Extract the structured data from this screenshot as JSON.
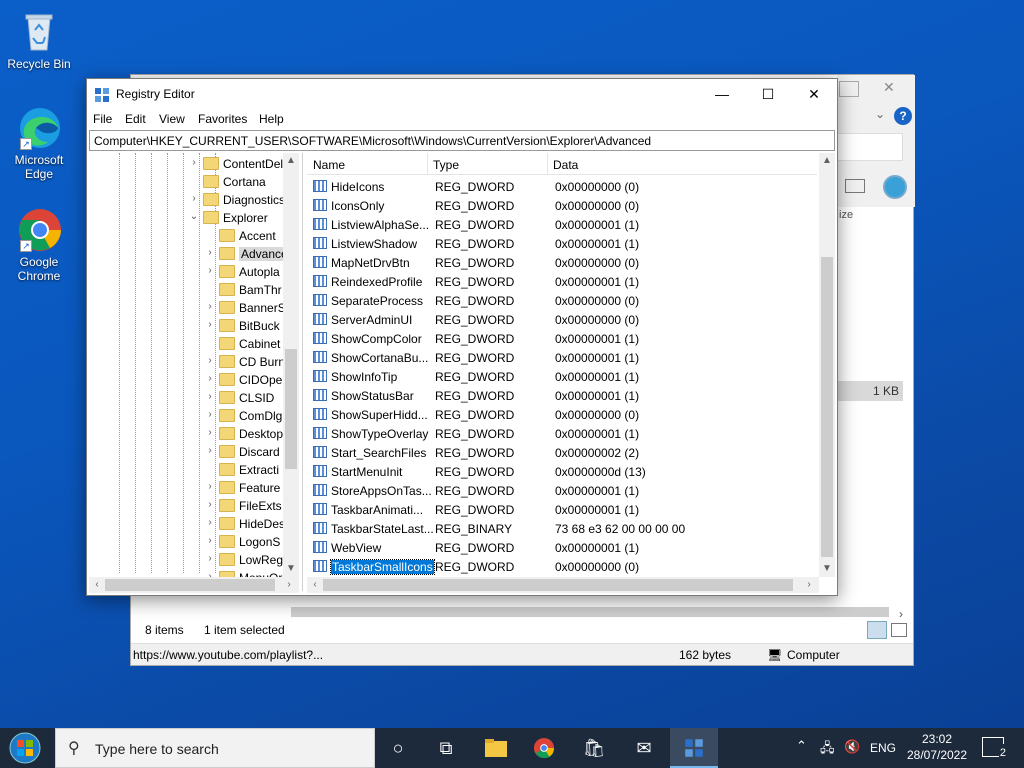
{
  "desktop": {
    "icons": [
      {
        "label": "Recycle Bin"
      },
      {
        "label": "Microsoft Edge"
      },
      {
        "label": "Google Chrome"
      }
    ]
  },
  "background_window": {
    "status_items_count": "8 items",
    "status_selected": "1 item selected",
    "status_url": "https://www.youtube.com/playlist?...",
    "status_size": "162 bytes",
    "status_location": "Computer",
    "column_size": "ize",
    "file_size": "1 KB"
  },
  "regedit": {
    "title": "Registry Editor",
    "menu": [
      "File",
      "Edit",
      "View",
      "Favorites",
      "Help"
    ],
    "address": "Computer\\HKEY_CURRENT_USER\\SOFTWARE\\Microsoft\\Windows\\CurrentVersion\\Explorer\\Advanced",
    "tree": [
      {
        "label": "ContentDel",
        "level": 1,
        "expander": "›"
      },
      {
        "label": "Cortana",
        "level": 1,
        "expander": ""
      },
      {
        "label": "Diagnostics",
        "level": 1,
        "expander": "›"
      },
      {
        "label": "Explorer",
        "level": 1,
        "expander": "⌄"
      },
      {
        "label": "Accent",
        "level": 2,
        "expander": ""
      },
      {
        "label": "Advance",
        "level": 2,
        "expander": "›",
        "selected": true
      },
      {
        "label": "Autopla",
        "level": 2,
        "expander": "›"
      },
      {
        "label": "BamThr",
        "level": 2,
        "expander": ""
      },
      {
        "label": "BannerS",
        "level": 2,
        "expander": "›"
      },
      {
        "label": "BitBuck",
        "level": 2,
        "expander": "›"
      },
      {
        "label": "Cabinet",
        "level": 2,
        "expander": ""
      },
      {
        "label": "CD Burn",
        "level": 2,
        "expander": "›"
      },
      {
        "label": "CIDOpe",
        "level": 2,
        "expander": "›"
      },
      {
        "label": "CLSID",
        "level": 2,
        "expander": "›"
      },
      {
        "label": "ComDlg",
        "level": 2,
        "expander": "›"
      },
      {
        "label": "Desktop",
        "level": 2,
        "expander": "›"
      },
      {
        "label": "Discard",
        "level": 2,
        "expander": "›"
      },
      {
        "label": "Extracti",
        "level": 2,
        "expander": ""
      },
      {
        "label": "Feature",
        "level": 2,
        "expander": "›"
      },
      {
        "label": "FileExts",
        "level": 2,
        "expander": "›"
      },
      {
        "label": "HideDes",
        "level": 2,
        "expander": "›"
      },
      {
        "label": "LogonS",
        "level": 2,
        "expander": "›"
      },
      {
        "label": "LowReg",
        "level": 2,
        "expander": "›"
      },
      {
        "label": "MenuOr",
        "level": 2,
        "expander": "›"
      }
    ],
    "columns": {
      "name": "Name",
      "type": "Type",
      "data": "Data"
    },
    "values": [
      {
        "name": "HideIcons",
        "type": "REG_DWORD",
        "data": "0x00000000 (0)"
      },
      {
        "name": "IconsOnly",
        "type": "REG_DWORD",
        "data": "0x00000000 (0)"
      },
      {
        "name": "ListviewAlphaSe...",
        "type": "REG_DWORD",
        "data": "0x00000001 (1)"
      },
      {
        "name": "ListviewShadow",
        "type": "REG_DWORD",
        "data": "0x00000001 (1)"
      },
      {
        "name": "MapNetDrvBtn",
        "type": "REG_DWORD",
        "data": "0x00000000 (0)"
      },
      {
        "name": "ReindexedProfile",
        "type": "REG_DWORD",
        "data": "0x00000001 (1)"
      },
      {
        "name": "SeparateProcess",
        "type": "REG_DWORD",
        "data": "0x00000000 (0)"
      },
      {
        "name": "ServerAdminUI",
        "type": "REG_DWORD",
        "data": "0x00000000 (0)"
      },
      {
        "name": "ShowCompColor",
        "type": "REG_DWORD",
        "data": "0x00000001 (1)"
      },
      {
        "name": "ShowCortanaBu...",
        "type": "REG_DWORD",
        "data": "0x00000001 (1)"
      },
      {
        "name": "ShowInfoTip",
        "type": "REG_DWORD",
        "data": "0x00000001 (1)"
      },
      {
        "name": "ShowStatusBar",
        "type": "REG_DWORD",
        "data": "0x00000001 (1)"
      },
      {
        "name": "ShowSuperHidd...",
        "type": "REG_DWORD",
        "data": "0x00000000 (0)"
      },
      {
        "name": "ShowTypeOverlay",
        "type": "REG_DWORD",
        "data": "0x00000001 (1)"
      },
      {
        "name": "Start_SearchFiles",
        "type": "REG_DWORD",
        "data": "0x00000002 (2)"
      },
      {
        "name": "StartMenuInit",
        "type": "REG_DWORD",
        "data": "0x0000000d (13)"
      },
      {
        "name": "StoreAppsOnTas...",
        "type": "REG_DWORD",
        "data": "0x00000001 (1)"
      },
      {
        "name": "TaskbarAnimati...",
        "type": "REG_DWORD",
        "data": "0x00000001 (1)"
      },
      {
        "name": "TaskbarStateLast...",
        "type": "REG_BINARY",
        "data": "73 68 e3 62 00 00 00 00"
      },
      {
        "name": "WebView",
        "type": "REG_DWORD",
        "data": "0x00000001 (1)"
      },
      {
        "name": "TaskbarSmallIcons",
        "type": "REG_DWORD",
        "data": "0x00000000 (0)",
        "selected": true
      }
    ]
  },
  "taskbar": {
    "search_placeholder": "Type here to search",
    "language": "ENG",
    "time": "23:02",
    "date": "28/07/2022",
    "notification_count": "2"
  }
}
